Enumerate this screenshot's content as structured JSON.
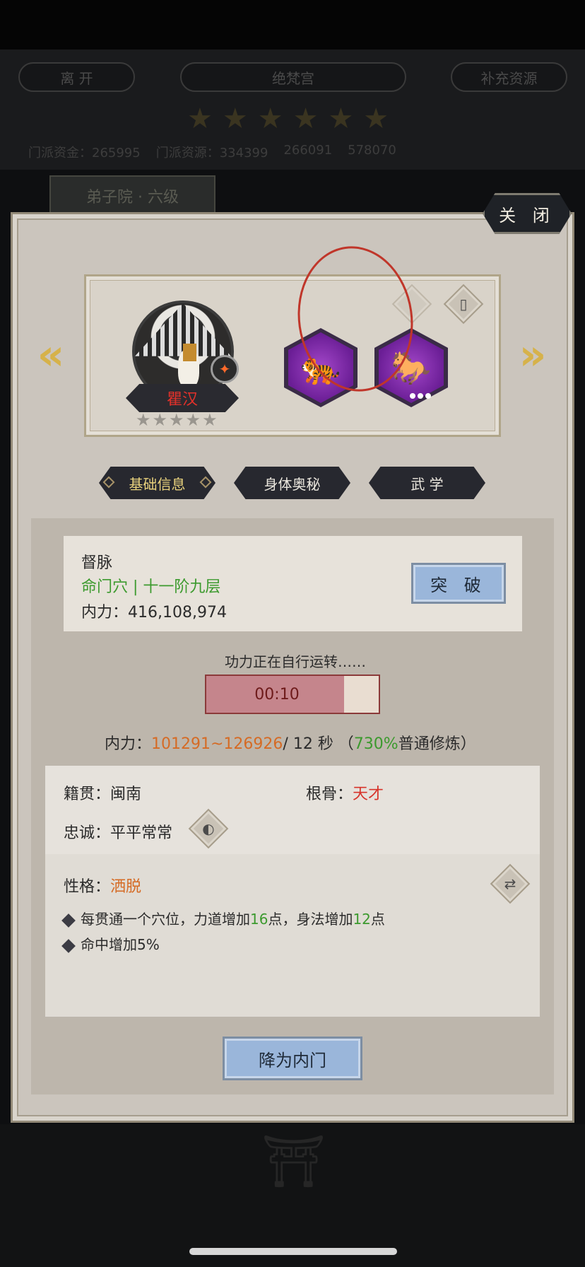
{
  "background": {
    "leave_button": "离 开",
    "sect_name": "绝梵宫",
    "supplement_button": "补充资源",
    "stars_count": 6,
    "stat_1": "门派资金：265995",
    "stat_2": "门派资源：334399",
    "stat_3": "266091",
    "stat_4": "578070",
    "tab_label": "弟子院 · 六级"
  },
  "dialog": {
    "close_label": "关 闭",
    "character": {
      "name": "瞿汉",
      "stars": 5
    },
    "tabs": [
      {
        "label": "基础信息",
        "active": true
      },
      {
        "label": "身体奥秘",
        "active": false
      },
      {
        "label": "武 学",
        "active": false
      }
    ],
    "meridian": {
      "title": "督脉",
      "level": "命门穴 | 十一阶九层",
      "inner_power_label": "内力：",
      "inner_power_value": "416,108,974",
      "breakthrough_button": "突 破"
    },
    "cultivation": {
      "status_text": "功力正在自行运转……",
      "timer": "00:10",
      "progress": 0.8,
      "rate_label": "内力：",
      "rate_range": "101291~126926",
      "rate_per": "/ 12 秒 （",
      "rate_percent": "730%",
      "rate_mode": "普通修炼）"
    },
    "info": {
      "origin_label": "籍贯：",
      "origin_value": "闽南",
      "talent_label": "根骨：",
      "talent_value": "天才",
      "loyalty_label": "忠诚：",
      "loyalty_value": "平平常常",
      "personality_label": "性格：",
      "personality_value": "洒脱",
      "trait_1_prefix": "每贯通一个穴位，力道增加",
      "trait_1_num1": "16",
      "trait_1_mid": "点，身法增加",
      "trait_1_num2": "12",
      "trait_1_suffix": "点",
      "trait_2": "命中增加5%"
    },
    "demote_button": "降为内门"
  },
  "colors": {
    "accent_green": "#3c9a2e",
    "accent_orange": "#d56b25",
    "accent_red": "#d7342b",
    "button_blue": "#9ab6da"
  },
  "icons": {
    "left_arrow": "chevron-left-icon",
    "right_arrow": "chevron-right-icon",
    "tiger_mount": "tiger-icon",
    "horse_mount": "horse-icon",
    "door": "door-icon",
    "bag": "bag-icon",
    "swap": "swap-icon"
  }
}
